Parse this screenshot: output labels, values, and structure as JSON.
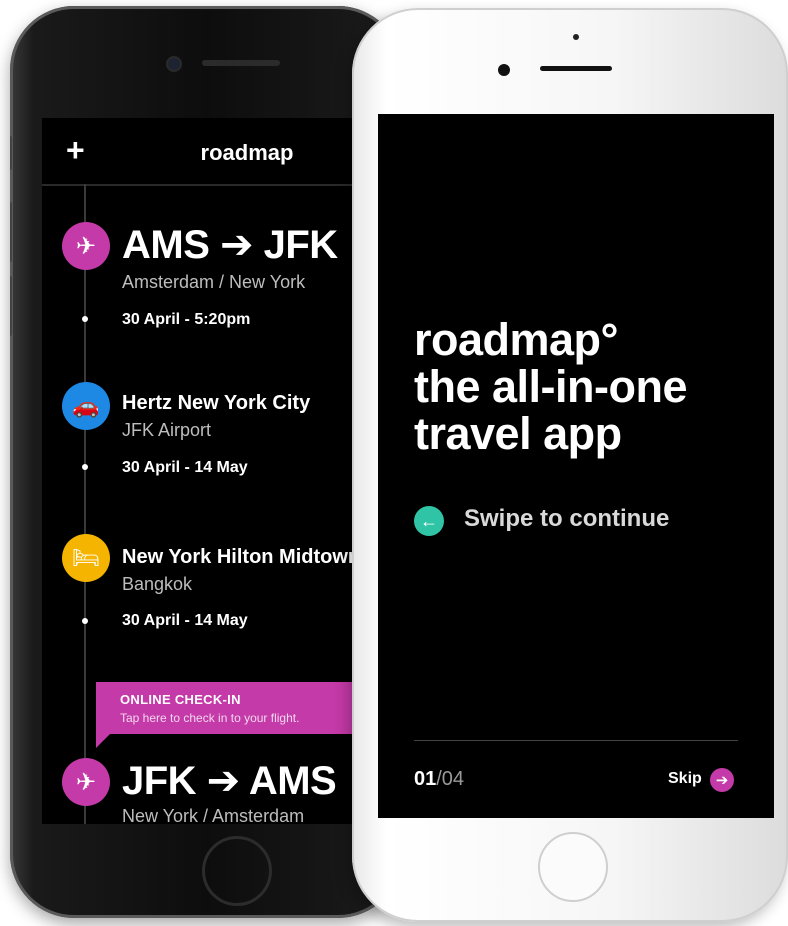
{
  "back_screen": {
    "topbar": {
      "add_label": "+",
      "title": "roadmap"
    },
    "items": [
      {
        "icon": "plane-icon",
        "icon_glyph": "✈",
        "color": "#c43aa8",
        "title": "AMS ➔ JFK",
        "subtitle": "Amsterdam / New York",
        "date": "30 April - 5:20pm"
      },
      {
        "icon": "car-icon",
        "icon_glyph": "🚗",
        "color": "#1e88e5",
        "title": "Hertz New York City",
        "subtitle": "JFK Airport",
        "date": "30 April - 14 May"
      },
      {
        "icon": "bed-icon",
        "icon_glyph": "🛏",
        "color": "#f5b400",
        "title": "New York Hilton Midtown",
        "subtitle": "Bangkok",
        "date": "30 April - 14 May"
      },
      {
        "icon": "plane-icon",
        "icon_glyph": "✈",
        "color": "#c43aa8",
        "title": "JFK ➔ AMS",
        "subtitle": "New York / Amsterdam"
      }
    ],
    "checkin": {
      "title": "ONLINE CHECK-IN",
      "subtitle": "Tap here to check in to your flight.",
      "color": "#c43aa8"
    }
  },
  "front_screen": {
    "headline": [
      "roadmap°",
      "the all-in-one",
      "travel app"
    ],
    "swipe": {
      "icon": "arrow-left-icon",
      "glyph": "←",
      "label": "Swipe to continue",
      "color": "#30c4a6"
    },
    "pager": {
      "current": "01",
      "total": "/04"
    },
    "skip": {
      "label": "Skip",
      "icon": "arrow-right-icon",
      "glyph": "➔",
      "color": "#c43aa8"
    }
  }
}
